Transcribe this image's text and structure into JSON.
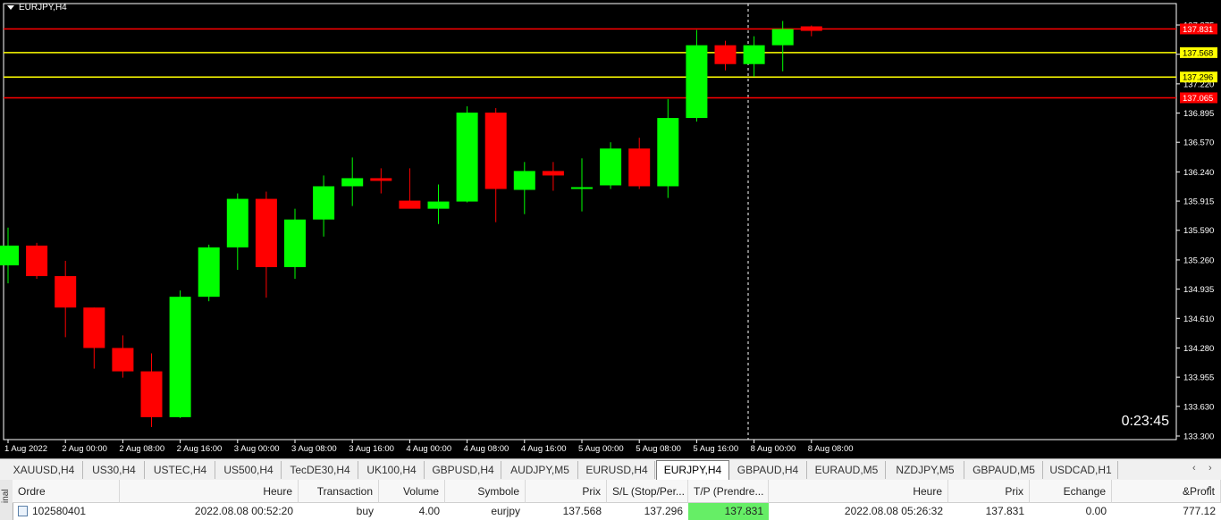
{
  "chart": {
    "title": "EURJPY,H4",
    "countdown": "0:23:45",
    "colors": {
      "background": "#000000",
      "bull": "#00ff00",
      "bear": "#ff0000",
      "resistance": "#ff0000",
      "support": "#ffff00",
      "axis_text": "#ffffff"
    },
    "price_axis": [
      "137.875",
      "137.550",
      "137.220",
      "136.895",
      "136.570",
      "136.240",
      "135.915",
      "135.590",
      "135.260",
      "134.935",
      "134.610",
      "134.280",
      "133.955",
      "133.630",
      "133.300"
    ],
    "time_axis": [
      "1 Aug 2022",
      "2 Aug 00:00",
      "2 Aug 08:00",
      "2 Aug 16:00",
      "3 Aug 00:00",
      "3 Aug 08:00",
      "3 Aug 16:00",
      "4 Aug 00:00",
      "4 Aug 08:00",
      "4 Aug 16:00",
      "5 Aug 00:00",
      "5 Aug 08:00",
      "5 Aug 16:00",
      "8 Aug 00:00",
      "8 Aug 08:00"
    ],
    "hlines": [
      {
        "price": 137.831,
        "label": "137.831",
        "kind": "resistance"
      },
      {
        "price": 137.568,
        "label": "137.568",
        "kind": "support"
      },
      {
        "price": 137.296,
        "label": "137.296",
        "kind": "support"
      },
      {
        "price": 137.065,
        "label": "137.065",
        "kind": "resistance"
      }
    ]
  },
  "chart_data": {
    "type": "candlestick",
    "title": "EURJPY,H4",
    "ylim": [
      133.3,
      137.875
    ],
    "candles": [
      {
        "o": 135.2,
        "h": 135.62,
        "l": 135.0,
        "c": 135.42
      },
      {
        "o": 135.42,
        "h": 135.45,
        "l": 135.05,
        "c": 135.08
      },
      {
        "o": 135.08,
        "h": 135.25,
        "l": 134.4,
        "c": 134.73
      },
      {
        "o": 134.73,
        "h": 134.73,
        "l": 134.05,
        "c": 134.28
      },
      {
        "o": 134.28,
        "h": 134.42,
        "l": 133.95,
        "c": 134.02
      },
      {
        "o": 134.02,
        "h": 134.22,
        "l": 133.4,
        "c": 133.51
      },
      {
        "o": 133.51,
        "h": 134.92,
        "l": 133.5,
        "c": 134.85
      },
      {
        "o": 134.85,
        "h": 135.43,
        "l": 134.8,
        "c": 135.4
      },
      {
        "o": 135.4,
        "h": 136.0,
        "l": 135.15,
        "c": 135.94
      },
      {
        "o": 135.94,
        "h": 136.02,
        "l": 134.84,
        "c": 135.18
      },
      {
        "o": 135.18,
        "h": 135.83,
        "l": 135.05,
        "c": 135.71
      },
      {
        "o": 135.71,
        "h": 136.2,
        "l": 135.52,
        "c": 136.08
      },
      {
        "o": 136.08,
        "h": 136.4,
        "l": 135.86,
        "c": 136.17
      },
      {
        "o": 136.17,
        "h": 136.28,
        "l": 136.0,
        "c": 136.14
      },
      {
        "o": 135.92,
        "h": 136.28,
        "l": 135.85,
        "c": 135.83
      },
      {
        "o": 135.83,
        "h": 136.1,
        "l": 135.66,
        "c": 135.91
      },
      {
        "o": 135.91,
        "h": 136.97,
        "l": 135.9,
        "c": 136.9
      },
      {
        "o": 136.9,
        "h": 136.95,
        "l": 135.68,
        "c": 136.05
      },
      {
        "o": 136.04,
        "h": 136.35,
        "l": 135.77,
        "c": 136.25
      },
      {
        "o": 136.25,
        "h": 136.35,
        "l": 136.03,
        "c": 136.2
      },
      {
        "o": 136.06,
        "h": 136.39,
        "l": 135.8,
        "c": 136.07
      },
      {
        "o": 136.09,
        "h": 136.57,
        "l": 136.05,
        "c": 136.5
      },
      {
        "o": 136.5,
        "h": 136.62,
        "l": 136.05,
        "c": 136.08
      },
      {
        "o": 136.08,
        "h": 137.05,
        "l": 135.95,
        "c": 136.84
      },
      {
        "o": 136.84,
        "h": 137.82,
        "l": 136.8,
        "c": 137.65
      },
      {
        "o": 137.65,
        "h": 137.7,
        "l": 137.37,
        "c": 137.44
      },
      {
        "o": 137.44,
        "h": 137.75,
        "l": 137.3,
        "c": 137.65
      },
      {
        "o": 137.65,
        "h": 137.92,
        "l": 137.36,
        "c": 137.83
      },
      {
        "o": 137.86,
        "h": 137.87,
        "l": 137.75,
        "c": 137.81
      }
    ]
  },
  "tabs": [
    {
      "label": "XAUUSD,H4",
      "active": false
    },
    {
      "label": "US30,H4",
      "active": false
    },
    {
      "label": "USTEC,H4",
      "active": false
    },
    {
      "label": "US500,H4",
      "active": false
    },
    {
      "label": "TecDE30,H4",
      "active": false
    },
    {
      "label": "UK100,H4",
      "active": false
    },
    {
      "label": "GBPUSD,H4",
      "active": false
    },
    {
      "label": "AUDJPY,M5",
      "active": false
    },
    {
      "label": "EURUSD,H4",
      "active": false
    },
    {
      "label": "EURJPY,H4",
      "active": true
    },
    {
      "label": "GBPAUD,H4",
      "active": false
    },
    {
      "label": "EURAUD,M5",
      "active": false
    },
    {
      "label": "NZDJPY,M5",
      "active": false
    },
    {
      "label": "GBPAUD,M5",
      "active": false
    },
    {
      "label": "USDCAD,H1",
      "active": false
    }
  ],
  "terminal": {
    "side_label": "inal",
    "headers": [
      "Ordre",
      "Heure",
      "Transaction",
      "Volume",
      "Symbole",
      "Prix",
      "S/L (Stop/Per...",
      "T/P (Prendre...",
      "Heure",
      "Prix",
      "Echange",
      "&Profit"
    ],
    "row": [
      "102580401",
      "2022.08.08 00:52:20",
      "buy",
      "4.00",
      "eurjpy",
      "137.568",
      "137.296",
      "137.831",
      "2022.08.08 05:26:32",
      "137.831",
      "0.00",
      "777.12"
    ],
    "tp_highlight": "#66ee66"
  }
}
